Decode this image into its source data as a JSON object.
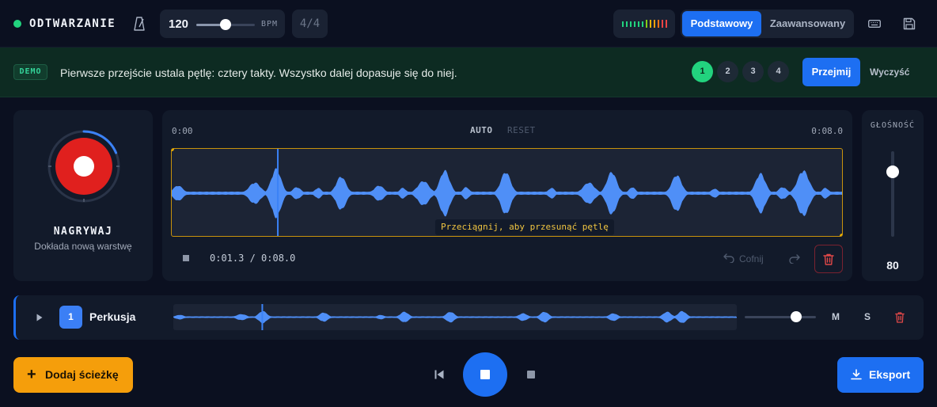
{
  "header": {
    "status_label": "ODTWARZANIE",
    "status_color": "#22d37e",
    "metronome_icon": "metronome-icon",
    "tempo": {
      "value": "120",
      "unit": "BPM",
      "slider_fraction": 0.5
    },
    "time_signature": "4/4",
    "level_meter_colors": [
      "#22d37e",
      "#22d37e",
      "#22d37e",
      "#22d37e",
      "#22d37e",
      "#22d37e",
      "#84cc16",
      "#eab308",
      "#f59e0b",
      "#f97316",
      "#ef4444",
      "#ef4444"
    ],
    "mode_basic_label": "Podstawowy",
    "mode_advanced_label": "Zaawansowany",
    "active_mode": "Podstawowy",
    "keyboard_icon": "keyboard-icon",
    "save_icon": "save-icon"
  },
  "banner": {
    "badge": "DEMO",
    "message": "Pierwsze przejście ustala pętlę: cztery takty. Wszystko dalej dopasuje się do niej.",
    "bar_options": [
      "1",
      "2",
      "3",
      "4"
    ],
    "selected_bar": "1",
    "accept_label": "Przejmij",
    "clear_label": "Wyczyść"
  },
  "record": {
    "label": "NAGRYWAJ",
    "sublabel": "Dokłada nową warstwę",
    "accent_color": "#e0201e"
  },
  "editor": {
    "time_start": "0:00",
    "time_end": "0:08.0",
    "auto_label": "AUTO",
    "reset_label": "RESET",
    "drag_hint": "Przeciągnij, aby przesunąć pętlę",
    "position_readout": "0:01.3 / 0:08.0",
    "undo_label": "Cofnij",
    "playhead_fraction": 0.1579,
    "wave_color": "#4f8ff7",
    "loop_border_color": "#c8920c"
  },
  "volume": {
    "label": "GŁOŚNOŚĆ",
    "value": "80",
    "fraction": 0.8
  },
  "track": {
    "number": "1",
    "name": "Perkusja",
    "volume_fraction": 0.72,
    "mute_label": "M",
    "solo_label": "S"
  },
  "footer": {
    "add_track_label": "Dodaj ścieżkę",
    "export_label": "Eksport"
  }
}
